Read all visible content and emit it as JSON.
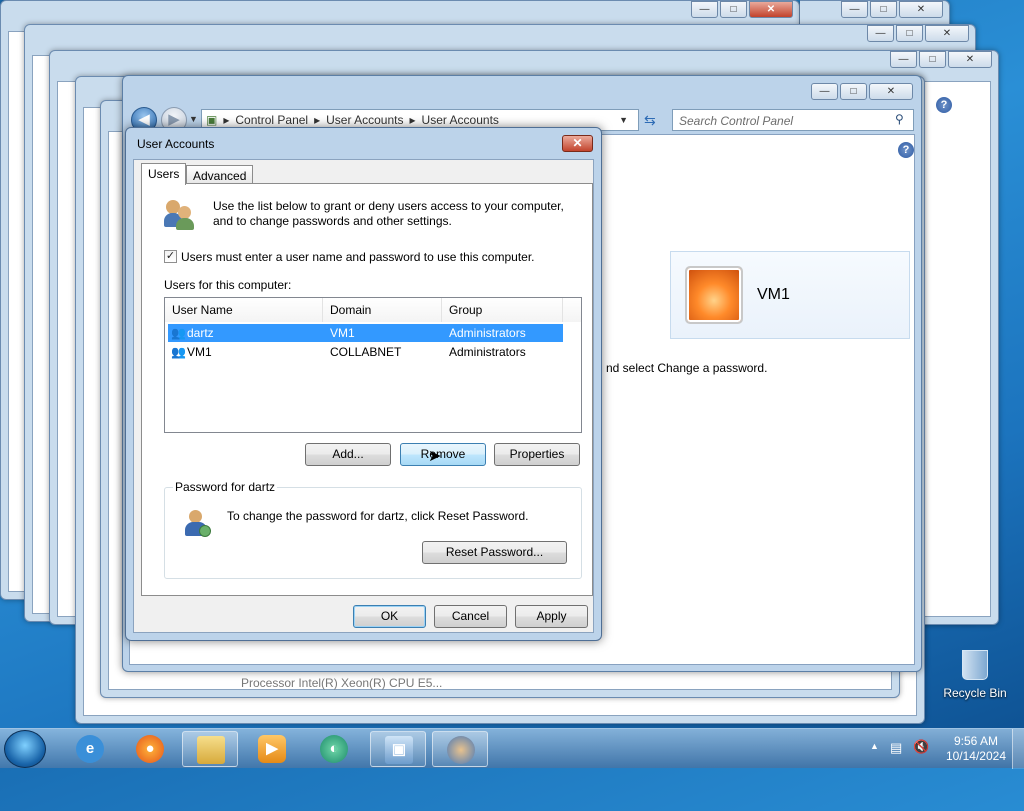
{
  "desktop": {
    "recycle_bin_label": "Recycle Bin",
    "bg_processor_text": "Processor  Intel(R) Xeon(R) CPU E5..."
  },
  "control_panel": {
    "breadcrumb": [
      "Control Panel",
      "User Accounts",
      "User Accounts"
    ],
    "search_placeholder": "Search Control Panel",
    "user_card_name": "VM1",
    "partial_text": "nd select Change a password."
  },
  "dialog": {
    "title": "User Accounts",
    "close_glyph": "✕",
    "tabs": [
      "Users",
      "Advanced"
    ],
    "intro_text_line1": "Use the list below to grant or deny users access to your computer,",
    "intro_text_line2": "and to change passwords and other settings.",
    "require_login_label": "Users must enter a user name and password to use this computer.",
    "require_login_checked": true,
    "users_label": "Users for this computer:",
    "columns": [
      "User Name",
      "Domain",
      "Group"
    ],
    "users": [
      {
        "name": "dartz",
        "domain": "VM1",
        "group": "Administrators",
        "selected": true
      },
      {
        "name": "VM1",
        "domain": "COLLABNET",
        "group": "Administrators",
        "selected": false
      }
    ],
    "buttons": {
      "add": "Add...",
      "remove": "Remove",
      "properties": "Properties",
      "reset_password": "Reset Password...",
      "ok": "OK",
      "cancel": "Cancel",
      "apply": "Apply"
    },
    "password_group_label": "Password for dartz",
    "password_text": "To change the password for dartz, click Reset Password."
  },
  "taskbar": {
    "time": "9:56 AM",
    "date": "10/14/2024",
    "apps": [
      "internet-explorer",
      "firefox",
      "file-explorer",
      "media-player",
      "app-green",
      "control-panel",
      "user-accounts"
    ]
  },
  "colors": {
    "selection": "#3399ff",
    "close_red": "#c2442d",
    "window_frame": "#bcd3ea"
  }
}
